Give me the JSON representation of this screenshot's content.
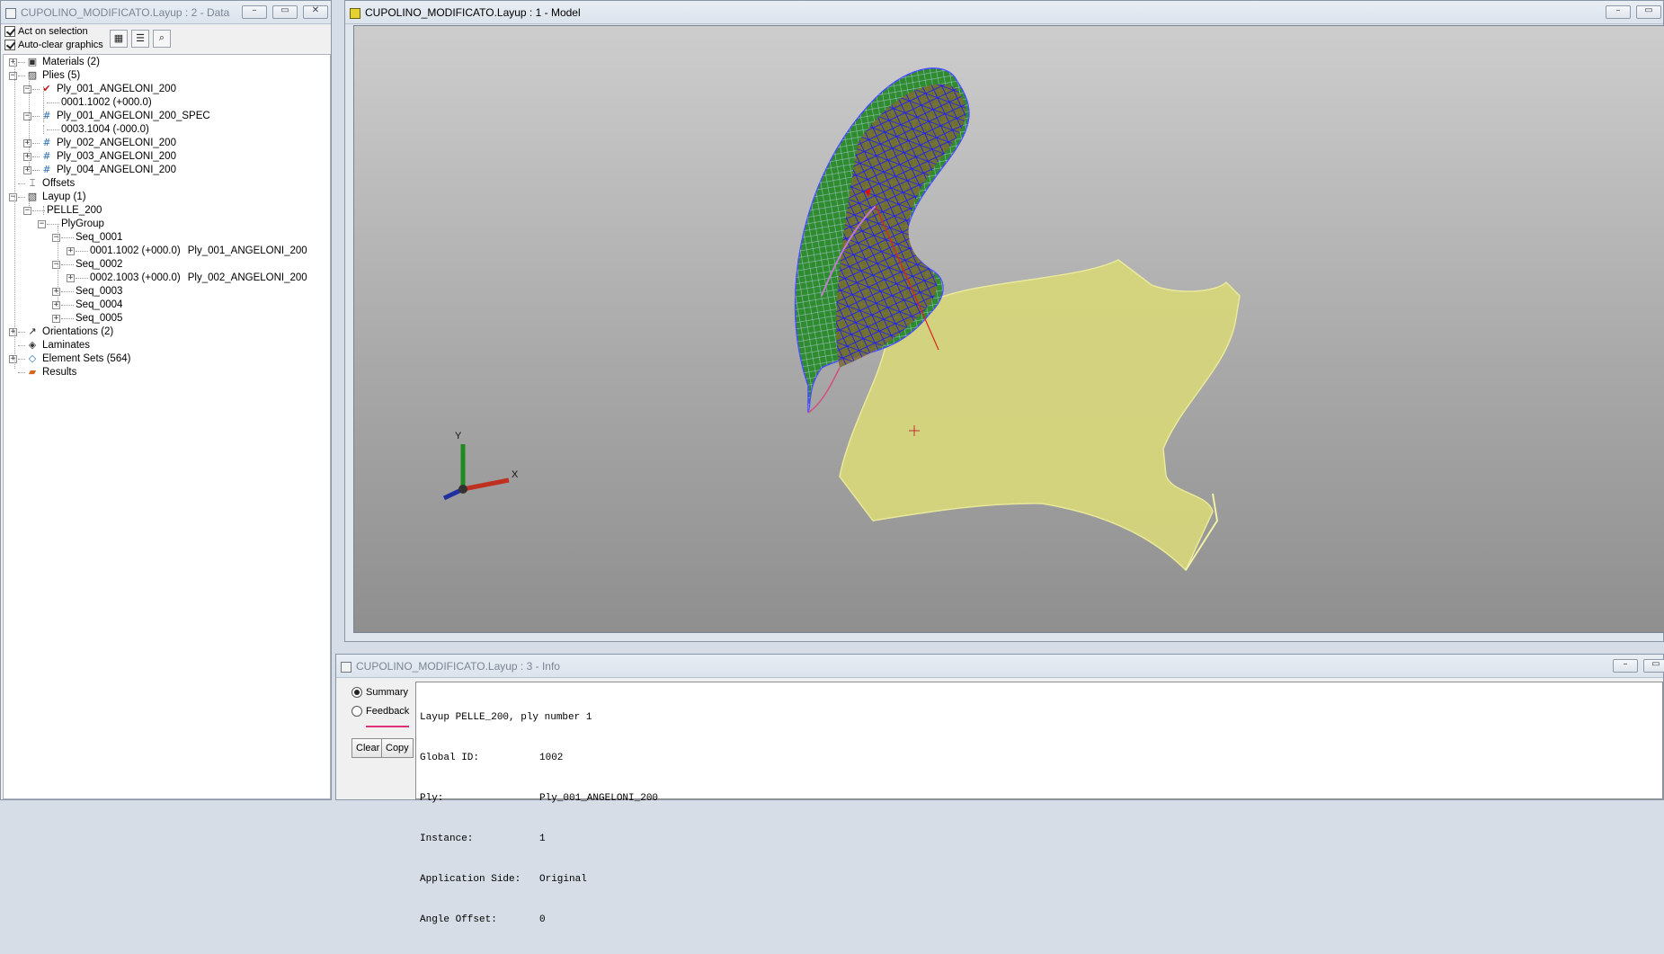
{
  "data_window": {
    "title": "CUPOLINO_MODIFICATO.Layup : 2 - Data",
    "options": [
      "Act on selection",
      "Auto-clear graphics"
    ]
  },
  "tree": [
    {
      "label": "Materials (2)",
      "label2": "",
      "icon": "▣",
      "icon_name": "materials-icon",
      "color": "#333"
    },
    {
      "label": "Plies (5)",
      "label2": "",
      "icon": "▨",
      "icon_name": "plies-icon",
      "color": "#333"
    },
    {
      "label": "Ply_001_ANGELONI_200",
      "label2": "",
      "icon": "✔",
      "icon_name": "check-icon",
      "color": "#c21818"
    },
    {
      "label": "0001.1002 (+000.0)",
      "label2": "",
      "icon": "",
      "icon_name": "",
      "color": ""
    },
    {
      "label": "Ply_001_ANGELONI_200_SPEC",
      "label2": "",
      "icon": "#",
      "icon_name": "ply-hash-icon",
      "color": "#2b6fb0"
    },
    {
      "label": "0003.1004 (-000.0)",
      "label2": "",
      "icon": "",
      "icon_name": "",
      "color": ""
    },
    {
      "label": "Ply_002_ANGELONI_200",
      "label2": "",
      "icon": "#",
      "icon_name": "ply-hash-icon",
      "color": "#2b6fb0"
    },
    {
      "label": "Ply_003_ANGELONI_200",
      "label2": "",
      "icon": "#",
      "icon_name": "ply-hash-icon",
      "color": "#2b6fb0"
    },
    {
      "label": "Ply_004_ANGELONI_200",
      "label2": "",
      "icon": "#",
      "icon_name": "ply-hash-icon",
      "color": "#2b6fb0"
    },
    {
      "label": "Offsets",
      "label2": "",
      "icon": "⌶",
      "icon_name": "offsets-icon",
      "color": "#333"
    },
    {
      "label": "Layup (1)",
      "label2": "",
      "icon": "▧",
      "icon_name": "layup-icon",
      "color": "#333"
    },
    {
      "label": "PELLE_200",
      "label2": "",
      "icon": "",
      "icon_name": "",
      "color": ""
    },
    {
      "label": "PlyGroup",
      "label2": "",
      "icon": "",
      "icon_name": "",
      "color": ""
    },
    {
      "label": "Seq_0001",
      "label2": "",
      "icon": "",
      "icon_name": "",
      "color": ""
    },
    {
      "label": "0001.1002 (+000.0)",
      "label2": "Ply_001_ANGELONI_200",
      "icon": "",
      "icon_name": "",
      "color": ""
    },
    {
      "label": "Seq_0002",
      "label2": "",
      "icon": "",
      "icon_name": "",
      "color": ""
    },
    {
      "label": "0002.1003 (+000.0)",
      "label2": "Ply_002_ANGELONI_200",
      "icon": "",
      "icon_name": "",
      "color": ""
    },
    {
      "label": "Seq_0003",
      "label2": "",
      "icon": "",
      "icon_name": "",
      "color": ""
    },
    {
      "label": "Seq_0004",
      "label2": "",
      "icon": "",
      "icon_name": "",
      "color": ""
    },
    {
      "label": "Seq_0005",
      "label2": "",
      "icon": "",
      "icon_name": "",
      "color": ""
    },
    {
      "label": "Orientations (2)",
      "label2": "",
      "icon": "↗",
      "icon_name": "orientations-icon",
      "color": "#222"
    },
    {
      "label": "Laminates",
      "label2": "",
      "icon": "◈",
      "icon_name": "laminates-icon",
      "color": "#333"
    },
    {
      "label": "Element Sets (564)",
      "label2": "",
      "icon": "◇",
      "icon_name": "element-sets-icon",
      "color": "#2b6fb0"
    },
    {
      "label": "Results",
      "label2": "",
      "icon": "▰",
      "icon_name": "results-icon",
      "color": "#d2691e"
    }
  ],
  "model_window": {
    "title": "CUPOLINO_MODIFICATO.Layup : 1 - Model",
    "axis_x": "X",
    "axis_y": "Y",
    "colors": {
      "mesh_green": "#2e8b2e",
      "mesh_blue": "#1a1aff",
      "ply_yellow": "#d9d87a",
      "background_top": "#cdcdcd",
      "background_bottom": "#8f8f8f"
    }
  },
  "info_window": {
    "title": "CUPOLINO_MODIFICATO.Layup : 3 - Info",
    "mode_summary": "Summary",
    "mode_feedback": "Feedback",
    "clear_label": "Clear",
    "copy_label": "Copy",
    "header_line": "Layup PELLE_200, ply number 1",
    "rows": [
      {
        "key": "Global ID:",
        "value": "1002"
      },
      {
        "key": "Ply:",
        "value": "Ply_001_ANGELONI_200"
      },
      {
        "key": "Instance:",
        "value": "1"
      },
      {
        "key": "Application Side:",
        "value": "Original"
      },
      {
        "key": "Angle Offset:",
        "value": "0"
      }
    ]
  }
}
